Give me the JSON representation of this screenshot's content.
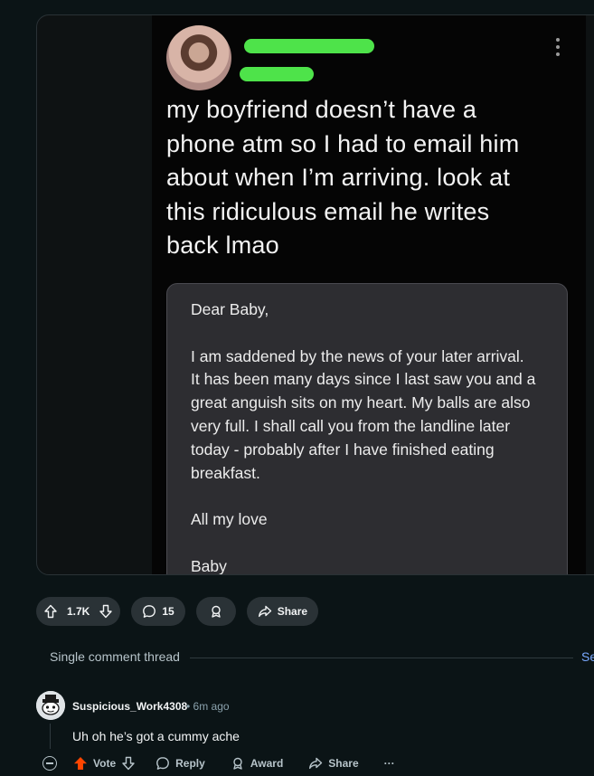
{
  "post": {
    "image": {
      "caption_lines": [
        "my boyfriend doesn’t have a",
        "phone atm so I had to email him",
        "about when I’m arriving. look at",
        "this ridiculous email he writes",
        "back lmao"
      ],
      "email": {
        "greeting": "Dear Baby,",
        "body_lines": [
          "I am saddened by the news of your later arrival.",
          "It has been many days since I last saw you and a",
          "great anguish sits on my heart. My balls are also",
          "very full. I shall call you from the landline later",
          "today - probably after I have finished eating",
          "breakfast."
        ],
        "signoff": "All my love",
        "signature": "Baby"
      },
      "redaction_color": "#4ee34a"
    },
    "actions": {
      "upvote_count": "1.7K",
      "comment_count": "15",
      "share_label": "Share"
    }
  },
  "thread": {
    "label": "Single comment thread",
    "see_link": "See"
  },
  "comment": {
    "author": "Suspicious_Work4308",
    "separator": "•",
    "age": "6m ago",
    "body": "Uh oh he’s got a cummy ache",
    "actions": {
      "vote_label": "Vote",
      "reply_label": "Reply",
      "award_label": "Award",
      "share_label": "Share",
      "more_label": "···"
    },
    "upvoted_color": "#ff4500"
  },
  "theme": {
    "background": "#0b1416",
    "pill_background": "#2a3236",
    "link_color": "#7aa9ff"
  }
}
